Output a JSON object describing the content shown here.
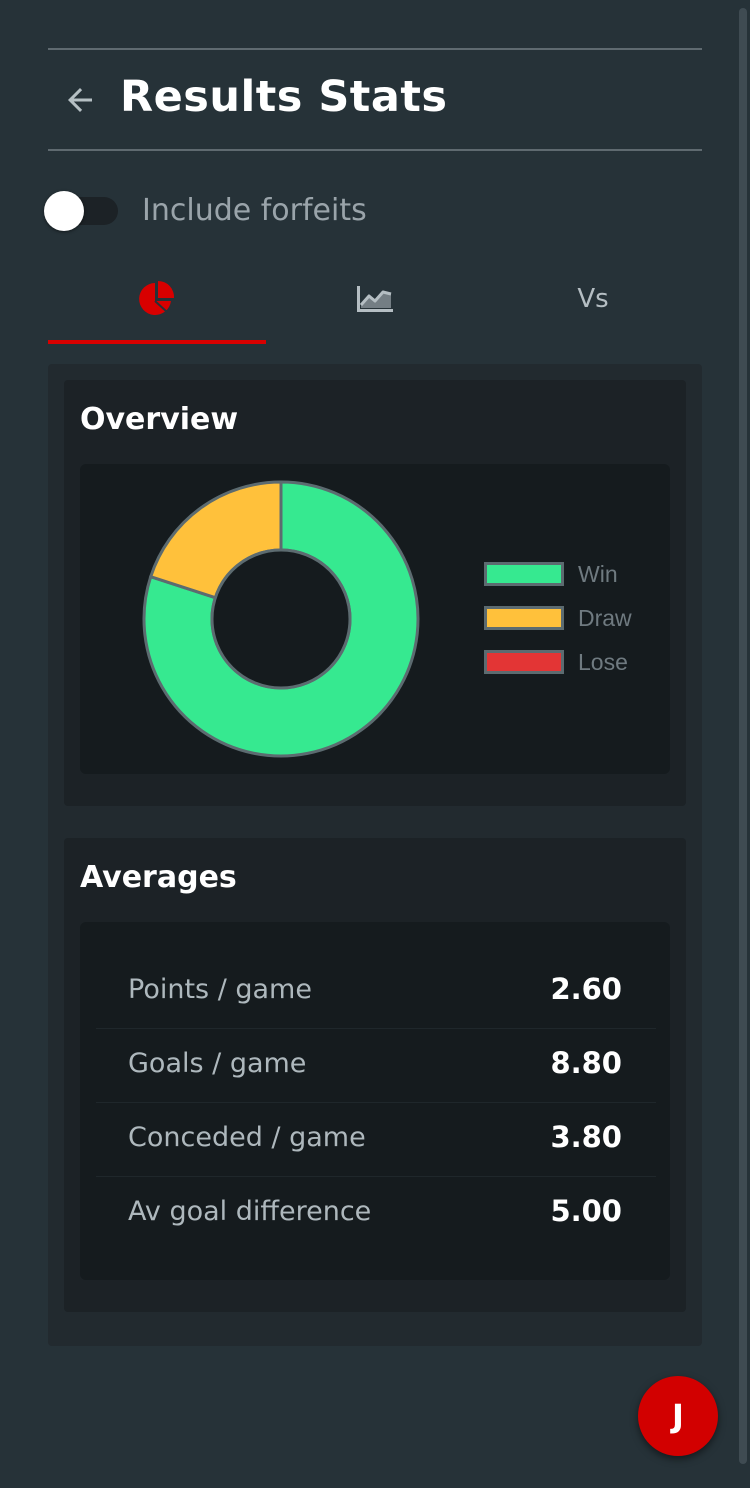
{
  "header": {
    "title": "Results Stats",
    "back_icon": "arrow-left-icon"
  },
  "toggle": {
    "label": "Include forfeits",
    "checked": false
  },
  "tabs": [
    {
      "icon": "pie-chart-icon",
      "label": "",
      "active": true
    },
    {
      "icon": "line-chart-icon",
      "label": "",
      "active": false
    },
    {
      "icon": "",
      "label": "Vs",
      "active": false
    }
  ],
  "overview": {
    "title": "Overview",
    "chart_data": {
      "type": "pie",
      "categories": [
        "Win",
        "Draw",
        "Lose"
      ],
      "values": [
        4,
        1,
        0
      ],
      "colors": [
        "#36e990",
        "#ffc13b",
        "#e33535"
      ],
      "legend_position": "right"
    }
  },
  "averages": {
    "title": "Averages",
    "rows": [
      {
        "label": "Points / game",
        "value": "2.60"
      },
      {
        "label": "Goals / game",
        "value": "8.80"
      },
      {
        "label": "Conceded / game",
        "value": "3.80"
      },
      {
        "label": "Av goal difference",
        "value": "5.00"
      }
    ]
  },
  "user": {
    "initial": "J"
  },
  "colors": {
    "accent": "#d80000",
    "background": "#263238"
  }
}
